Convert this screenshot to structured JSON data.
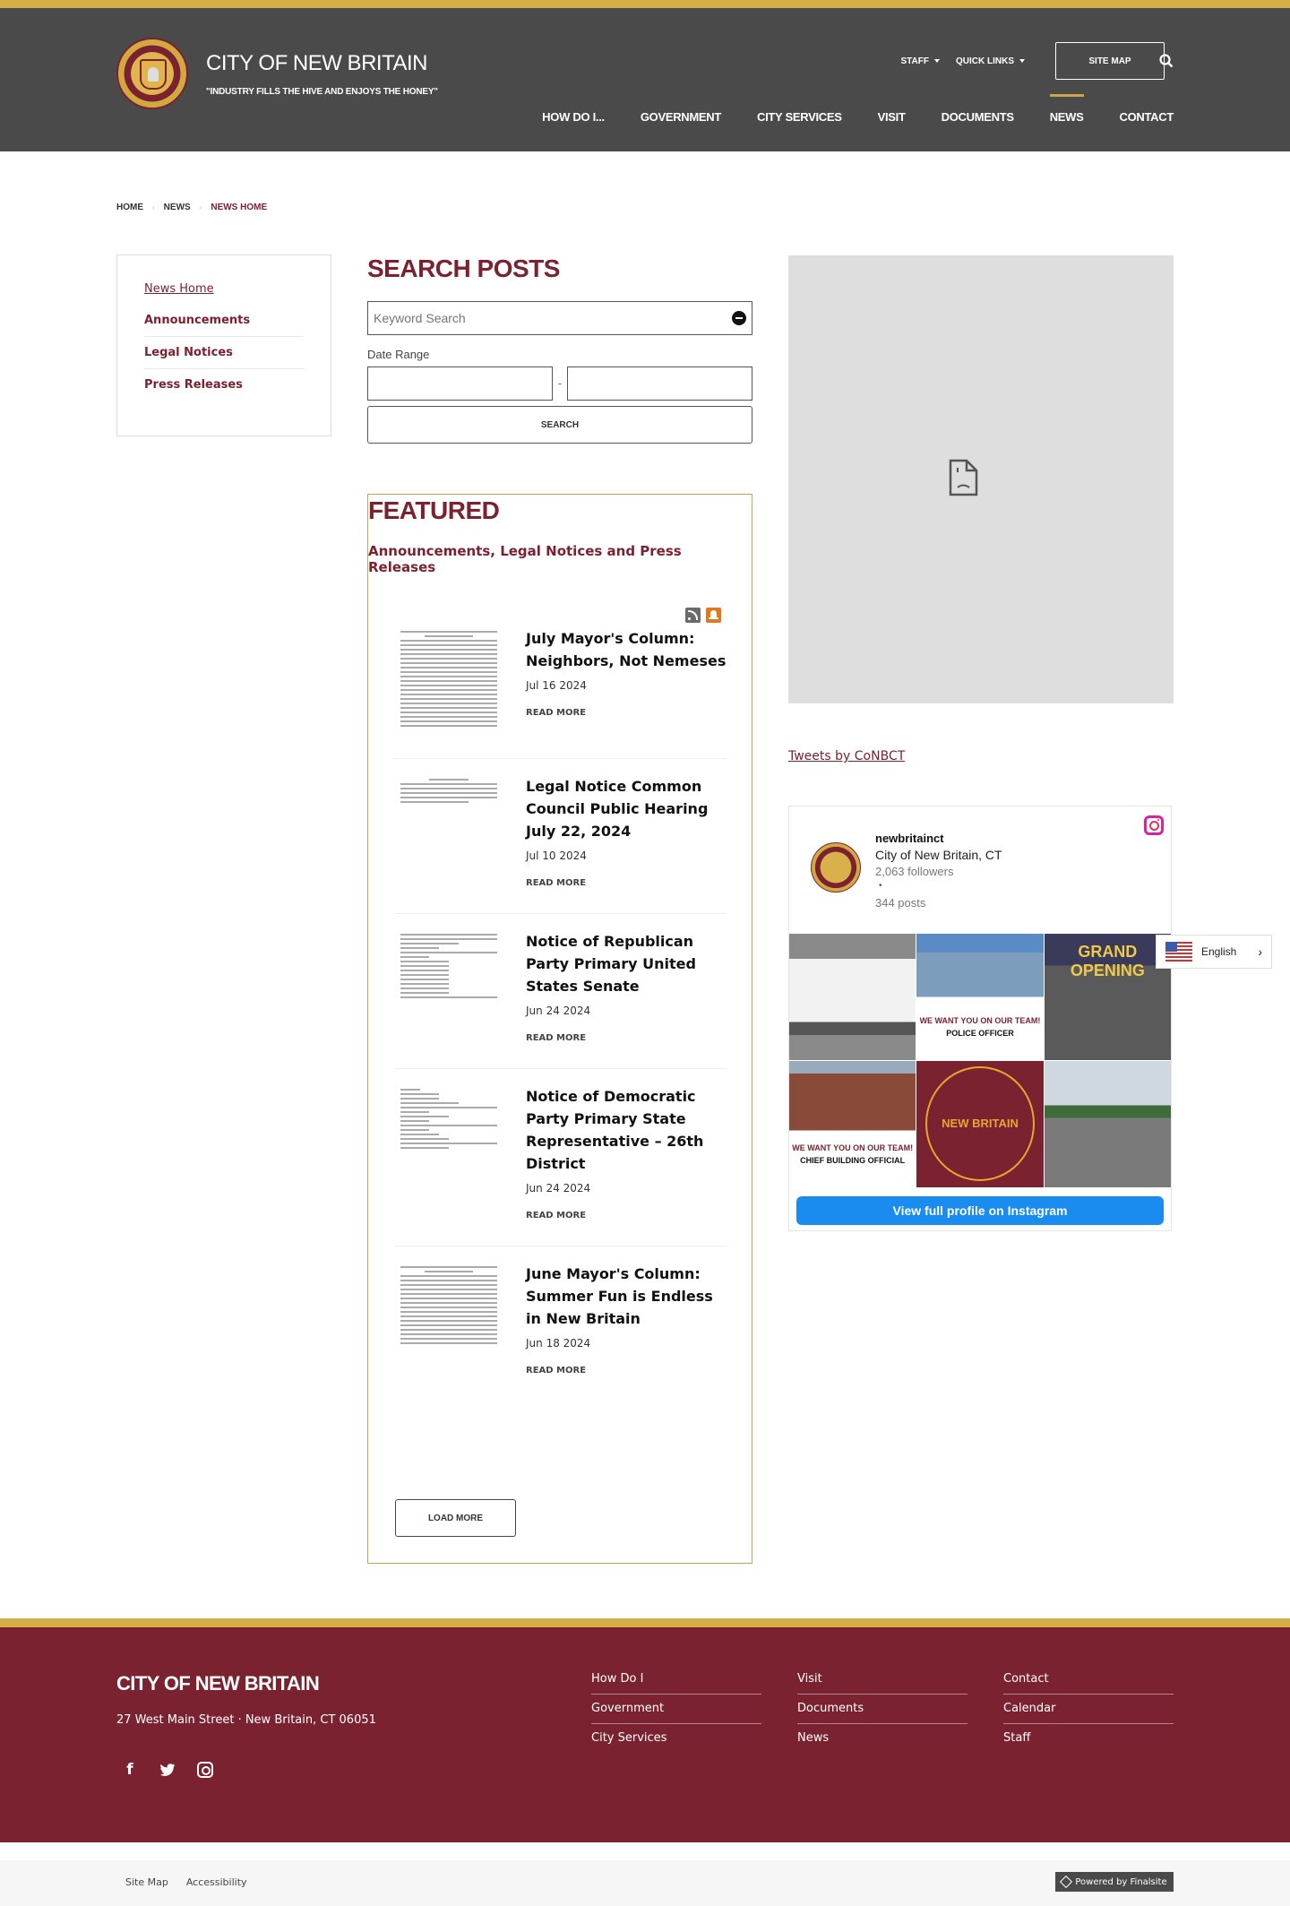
{
  "header": {
    "site_title": "CITY OF NEW BRITAIN",
    "motto": "\"INDUSTRY FILLS THE HIVE AND ENJOYS THE HONEY\"",
    "utility": [
      {
        "label": "STAFF",
        "has_dropdown": true
      },
      {
        "label": "QUICK LINKS",
        "has_dropdown": true
      }
    ],
    "site_map_label": "SITE MAP",
    "nav": [
      {
        "label": "HOW DO I..."
      },
      {
        "label": "GOVERNMENT"
      },
      {
        "label": "CITY SERVICES"
      },
      {
        "label": "VISIT"
      },
      {
        "label": "DOCUMENTS"
      },
      {
        "label": "NEWS",
        "active": true
      },
      {
        "label": "CONTACT"
      }
    ]
  },
  "breadcrumb": [
    "HOME",
    "NEWS",
    "NEWS HOME"
  ],
  "sidebar": {
    "items": [
      {
        "label": "News Home",
        "active": true
      },
      {
        "label": "Announcements"
      },
      {
        "label": "Legal Notices"
      },
      {
        "label": "Press Releases"
      }
    ]
  },
  "search": {
    "title": "SEARCH POSTS",
    "keyword_placeholder": "Keyword Search",
    "keyword_value": "",
    "date_range_label": "Date Range",
    "date_separator": "-",
    "date_from": "",
    "date_to": "",
    "button_label": "SEARCH"
  },
  "featured": {
    "title": "FEATURED",
    "subtitle": "Announcements, Legal Notices and Press Releases",
    "read_more_label": "READ MORE",
    "load_more_label": "LOAD MORE",
    "posts": [
      {
        "title": "July Mayor's Column: Neighbors, Not Nemeses",
        "date": "Jul 16 2024"
      },
      {
        "title": "Legal Notice Common Council Public Hearing July 22, 2024",
        "date": "Jul 10 2024"
      },
      {
        "title": "Notice of Republican Party Primary United States Senate",
        "date": "Jun 24 2024"
      },
      {
        "title": "Notice of Democratic Party Primary State Representative – 26th District",
        "date": "Jun 24 2024"
      },
      {
        "title": "June Mayor's Column: Summer Fun is Endless in New Britain",
        "date": "Jun 18 2024"
      }
    ]
  },
  "tweets_link": "Tweets by CoNBCT",
  "instagram": {
    "username": "newbritainct",
    "name": "City of New Britain, CT",
    "followers": "2,063 followers",
    "dot": "•",
    "posts": "344 posts",
    "tiles": [
      {
        "caption_a": "",
        "caption_b": ""
      },
      {
        "caption_a": "WE WANT YOU ON OUR TEAM!",
        "caption_b": "POLICE OFFICER"
      },
      {
        "caption_a": "GRAND OPENING",
        "caption_b": ""
      },
      {
        "caption_a": "WE WANT YOU ON OUR TEAM!",
        "caption_b": "CHIEF BUILDING OFFICIAL"
      },
      {
        "caption_a": "NEW BRITAIN",
        "caption_b": ""
      },
      {
        "caption_a": "",
        "caption_b": ""
      }
    ],
    "cta": "View full profile on Instagram"
  },
  "language": {
    "selected": "English"
  },
  "footer": {
    "title": "CITY OF NEW BRITAIN",
    "address": "27 West Main Street · New Britain, CT 06051",
    "columns": [
      [
        "How Do I",
        "Government",
        "City Services"
      ],
      [
        "Visit",
        "Documents",
        "News"
      ],
      [
        "Contact",
        "Calendar",
        "Staff"
      ]
    ],
    "bottom_links": [
      "Site Map",
      "Accessibility"
    ],
    "powered_by": "Powered by Finalsite"
  }
}
